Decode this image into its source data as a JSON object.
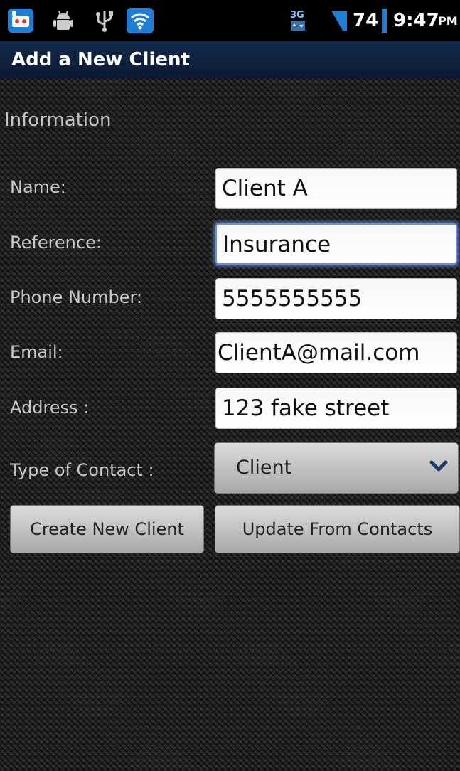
{
  "status_bar": {
    "icons": [
      "app-notification-icon",
      "debug-android-icon",
      "usb-icon",
      "wifi-icon",
      "signal-3g-icon",
      "battery-icon"
    ],
    "battery_level": "74",
    "time": "9:47",
    "ampm": "PM"
  },
  "title": "Add a New Client",
  "form": {
    "section_title": "Information",
    "name_label": "Name:",
    "name_value": "Client A",
    "reference_label": "Reference:",
    "reference_value": "Insurance",
    "phone_label": "Phone Number:",
    "phone_value": "5555555555",
    "email_label": "Email:",
    "email_value": "ClientA@mail.com",
    "address_label": "Address :",
    "address_value": "123 fake street",
    "contact_type_label": "Type of Contact  :",
    "contact_type_value": "Client"
  },
  "buttons": {
    "create": "Create New Client",
    "update": "Update From Contacts"
  },
  "colors": {
    "title_bar": "#0a1a33",
    "focus_glow": "#6a8fd8"
  }
}
